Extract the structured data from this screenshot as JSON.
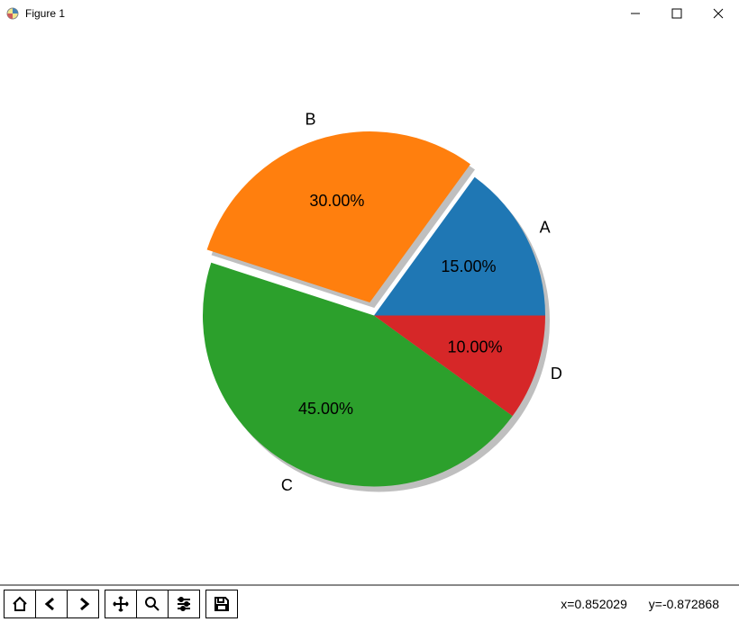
{
  "window": {
    "title": "Figure 1"
  },
  "status": {
    "x_label": "x=0.852029",
    "y_label": "y=-0.872868"
  },
  "chart_data": {
    "type": "pie",
    "title": "",
    "series": [
      {
        "name": "A",
        "value": 15,
        "percent_label": "15.00%",
        "color": "#1f77b4",
        "explode": 0
      },
      {
        "name": "B",
        "value": 30,
        "percent_label": "30.00%",
        "color": "#ff7f0e",
        "explode": 0.08
      },
      {
        "name": "C",
        "value": 45,
        "percent_label": "45.00%",
        "color": "#2ca02c",
        "explode": 0
      },
      {
        "name": "D",
        "value": 10,
        "percent_label": "10.00%",
        "color": "#d62728",
        "explode": 0
      }
    ],
    "start_angle_deg": 0,
    "direction": "counterclockwise",
    "shadow": true,
    "autopct_format": "%.2f%%"
  },
  "toolbar": {
    "home": "Home",
    "back": "Back",
    "forward": "Forward",
    "pan": "Pan",
    "zoom": "Zoom",
    "configure": "Configure subplots",
    "save": "Save"
  }
}
